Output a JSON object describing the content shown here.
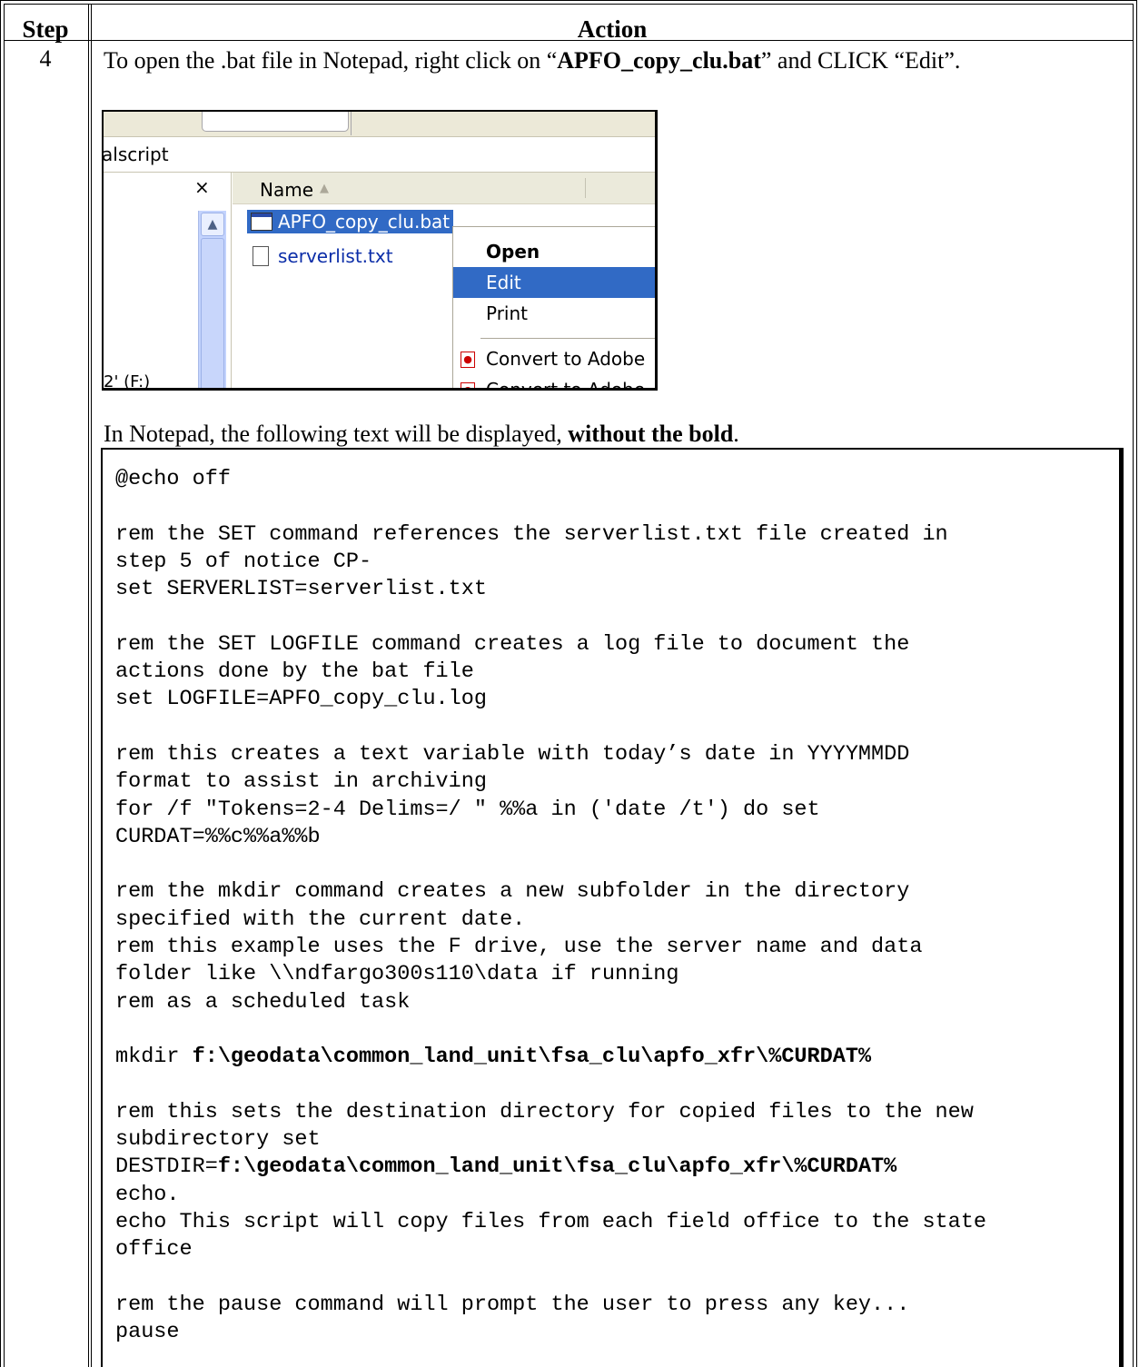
{
  "table": {
    "header_step": "Step",
    "header_action": "Action",
    "step_number": "4"
  },
  "instruction": {
    "prefix": "To open the .bat file in Notepad, right click on “",
    "filename": "APFO_copy_clu.bat",
    "suffix": "” and CLICK “Edit”."
  },
  "screenshot": {
    "address_fragment": "alscript",
    "close_glyph": "×",
    "column_name": "Name",
    "sort_glyph": "▲",
    "files": [
      "APFO_copy_clu.bat",
      "serverlist.txt"
    ],
    "drive_label": "2' (F:)",
    "menu": {
      "open": "Open",
      "edit": "Edit",
      "print": "Print",
      "convert1": "Convert to Adobe",
      "convert2": "Convert to Adobe"
    },
    "icons": [
      "bat-file-icon",
      "text-file-icon",
      "pdf-icon",
      "scroll-up-icon",
      "close-icon"
    ]
  },
  "note": {
    "prefix": "In Notepad, the following text will be displayed, ",
    "bold": "without the bold",
    "suffix": "."
  },
  "code_lines": [
    {
      "t": "@echo off"
    },
    {
      "t": ""
    },
    {
      "t": "rem the SET command references the serverlist.txt file created in"
    },
    {
      "t": "step 5 of notice CP-"
    },
    {
      "t": "set SERVERLIST=serverlist.txt"
    },
    {
      "t": ""
    },
    {
      "t": "rem the SET LOGFILE command creates a log file to document the"
    },
    {
      "t": "actions done by the bat file"
    },
    {
      "t": "set LOGFILE=APFO_copy_clu.log"
    },
    {
      "t": ""
    },
    {
      "t": "rem this creates a text variable with today’s date in YYYYMMDD"
    },
    {
      "t": "format to assist in archiving"
    },
    {
      "t": "for /f \"Tokens=2-4 Delims=/ \" %%a in ('date /t') do set"
    },
    {
      "t": "CURDAT=%%c%%a%%b"
    },
    {
      "t": ""
    },
    {
      "t": "rem the mkdir command creates a new subfolder in the directory"
    },
    {
      "t": "specified with the current date."
    },
    {
      "t": "rem this example uses the F drive, use the server name and data"
    },
    {
      "t": "folder like \\\\ndfargo300s110\\data if running"
    },
    {
      "t": "rem as a scheduled task"
    },
    {
      "t": ""
    },
    {
      "t": "mkdir ",
      "b": "f:\\geodata\\common_land_unit\\fsa_clu\\apfo_xfr\\%CURDAT%"
    },
    {
      "t": ""
    },
    {
      "t": "rem this sets the destination directory for copied files to the new"
    },
    {
      "t": "subdirectory set"
    },
    {
      "t": "DESTDIR=",
      "b": "f:\\geodata\\common_land_unit\\fsa_clu\\apfo_xfr\\%CURDAT%"
    },
    {
      "t": "echo."
    },
    {
      "t": "echo This script will copy files from each field office to the state"
    },
    {
      "t": "office"
    },
    {
      "t": ""
    },
    {
      "t": "rem the pause command will prompt the user to press any key..."
    },
    {
      "t": "pause"
    }
  ]
}
